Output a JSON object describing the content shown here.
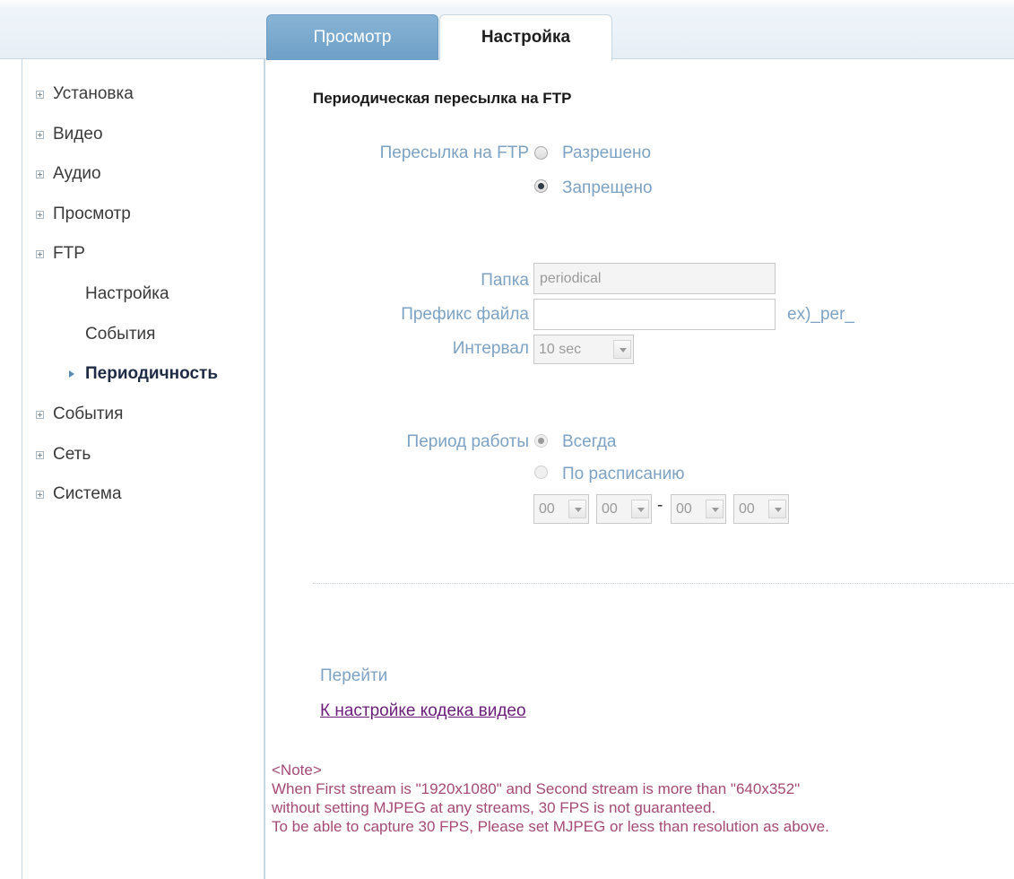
{
  "tabs": {
    "view": "Просмотр",
    "setup": "Настройка"
  },
  "sidebar": {
    "items": [
      {
        "label": "Установка"
      },
      {
        "label": "Видео"
      },
      {
        "label": "Аудио"
      },
      {
        "label": "Просмотр"
      },
      {
        "label": "FTP"
      },
      {
        "label": "События"
      },
      {
        "label": "Сеть"
      },
      {
        "label": "Система"
      }
    ],
    "ftp_sub": [
      {
        "label": "Настройка"
      },
      {
        "label": "События"
      },
      {
        "label": "Периодичность",
        "active": true
      }
    ]
  },
  "main": {
    "title": "Периодическая пересылка на FTP",
    "ftp_upload": {
      "label": "Пересылка на FTP",
      "enabled_label": "Разрешено",
      "disabled_label": "Запрещено",
      "selected": "Запрещено"
    },
    "folder": {
      "label": "Папка",
      "value": "periodical"
    },
    "prefix": {
      "label": "Префикс файла",
      "value": "",
      "hint": "ex)_per_"
    },
    "interval": {
      "label": "Интервал",
      "value": "10 sec"
    },
    "period": {
      "label": "Период работы",
      "always_label": "Всегда",
      "schedule_label": "По расписанию",
      "selected": "Всегда",
      "start_hour": "00",
      "start_min": "00",
      "separator": "-",
      "end_hour": "00",
      "end_min": "00"
    },
    "goto": {
      "label": "Перейти",
      "link": "К настройке кодека видео"
    },
    "note": {
      "header": "<Note>",
      "line1": "When First stream is \"1920x1080\" and Second stream is more than \"640x352\"",
      "line2": "without setting MJPEG at any streams, 30 FPS is not guaranteed.",
      "line3": "To be able to capture 30 FPS, Please set MJPEG or less than resolution as above."
    }
  }
}
